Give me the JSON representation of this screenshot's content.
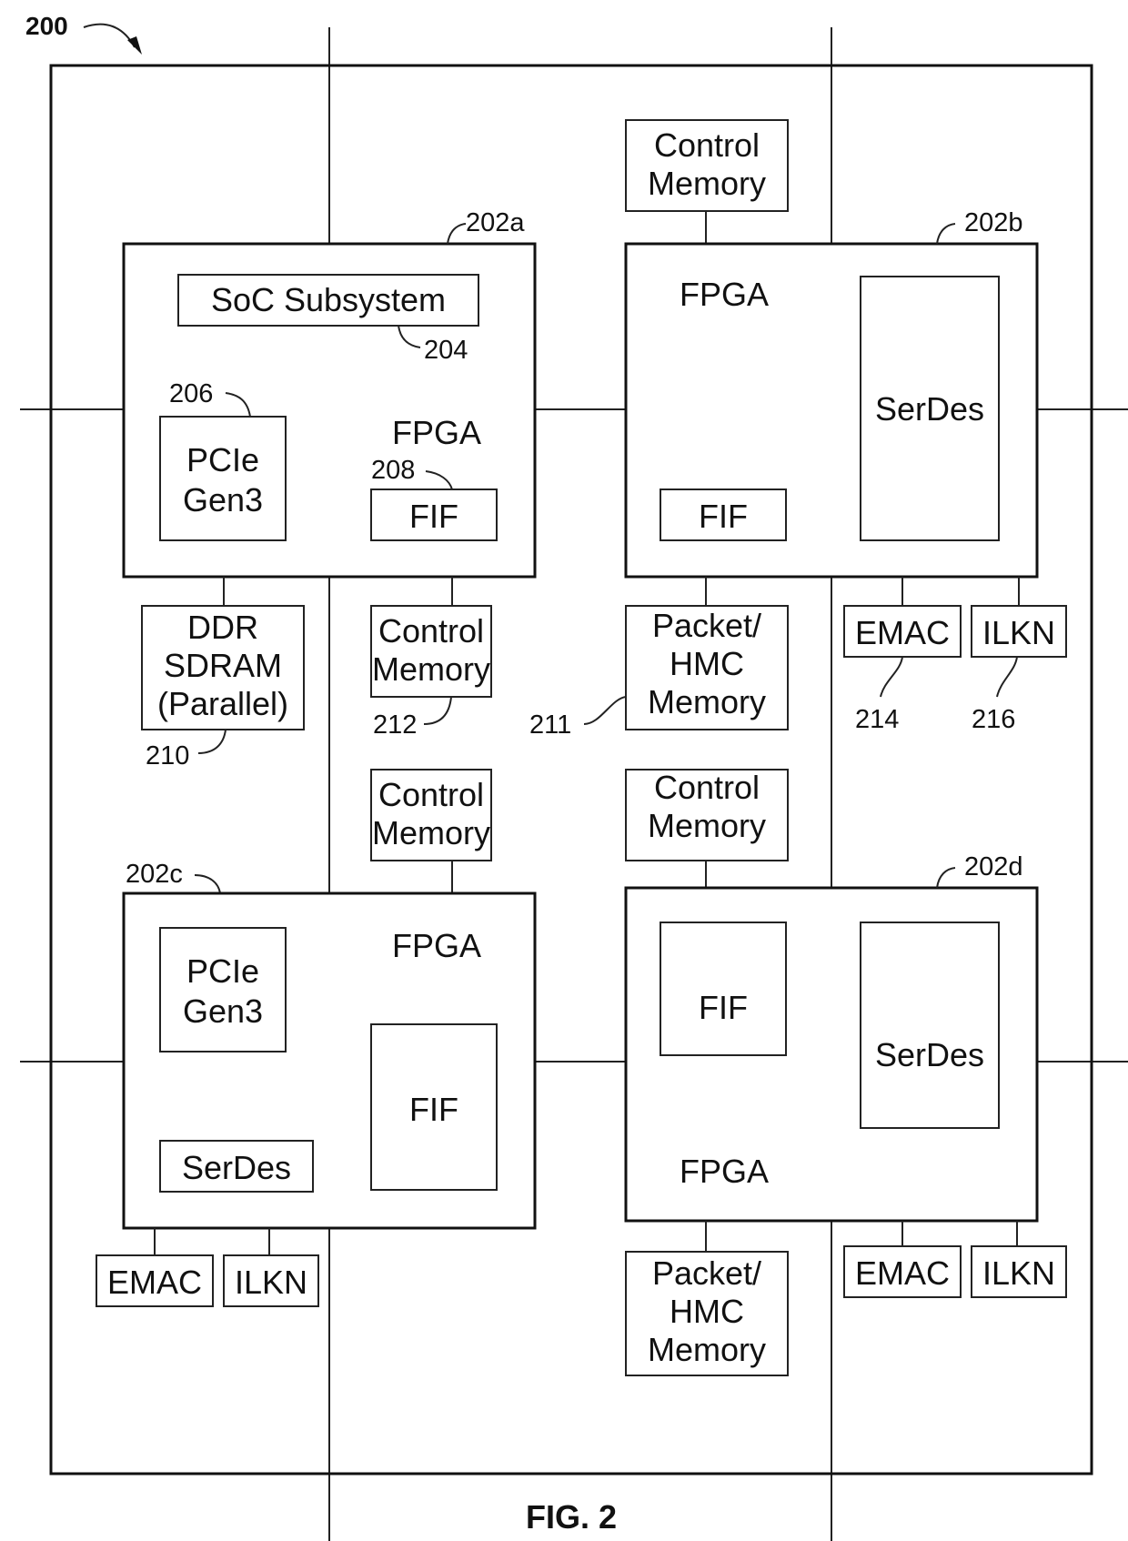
{
  "figure": {
    "ref_main": "200",
    "caption": "FIG. 2"
  },
  "chips": {
    "a": {
      "ref": "202a",
      "title": "FPGA",
      "soc": "SoC Subsystem",
      "soc_ref": "204",
      "pcie": [
        "PCIe",
        "Gen3"
      ],
      "pcie_ref": "206",
      "fif": "FIF",
      "fif_ref": "208"
    },
    "b": {
      "ref": "202b",
      "title": "FPGA",
      "fif": "FIF",
      "serdes": "SerDes"
    },
    "c": {
      "ref": "202c",
      "title": "FPGA",
      "pcie": [
        "PCIe",
        "Gen3"
      ],
      "fif": "FIF",
      "serdes": "SerDes"
    },
    "d": {
      "ref": "202d",
      "title": "FPGA",
      "fif": "FIF",
      "serdes": "SerDes"
    }
  },
  "external": {
    "ddr": [
      "DDR",
      "SDRAM",
      "(Parallel)"
    ],
    "ddr_ref": "210",
    "control_memory": [
      "Control",
      "Memory"
    ],
    "control_memory_ref": "212",
    "packet_memory": [
      "Packet/",
      "HMC",
      "Memory"
    ],
    "packet_memory_ref": "211",
    "emac": "EMAC",
    "emac_ref": "214",
    "ilkn": "ILKN",
    "ilkn_ref": "216"
  }
}
